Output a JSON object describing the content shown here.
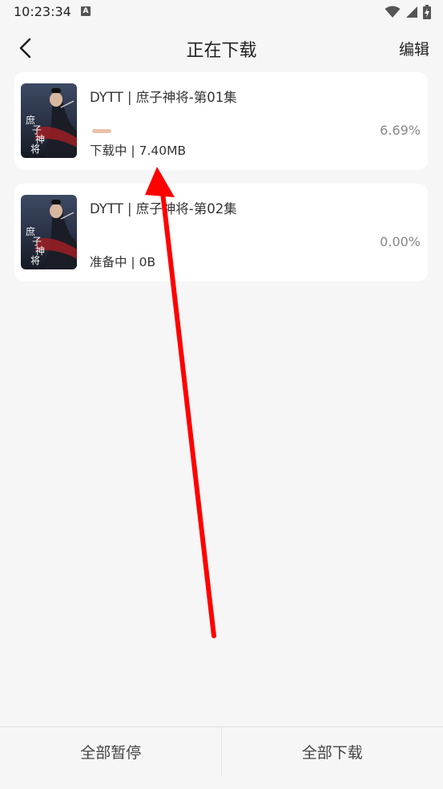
{
  "status_bar": {
    "time": "10:23:34",
    "notif_letter": "A"
  },
  "header": {
    "title": "正在下载",
    "edit_label": "编辑",
    "back_icon": "chevron-left"
  },
  "downloads": [
    {
      "title": "DYTT | 庶子神将-第01集",
      "status": "下载中 | 7.40MB",
      "percent": "6.69%",
      "progress": 0.0669,
      "poster_caption": "庶子神将"
    },
    {
      "title": "DYTT | 庶子神将-第02集",
      "status": "准备中 | 0B",
      "percent": "0.00%",
      "progress": 0.0,
      "poster_caption": "庶子神将"
    }
  ],
  "bottom_bar": {
    "pause_all": "全部暂停",
    "download_all": "全部下载"
  },
  "colors": {
    "background": "#f6f6f7",
    "card": "#ffffff",
    "progress": "#eac3a9",
    "annotation_arrow": "#ff0000"
  }
}
